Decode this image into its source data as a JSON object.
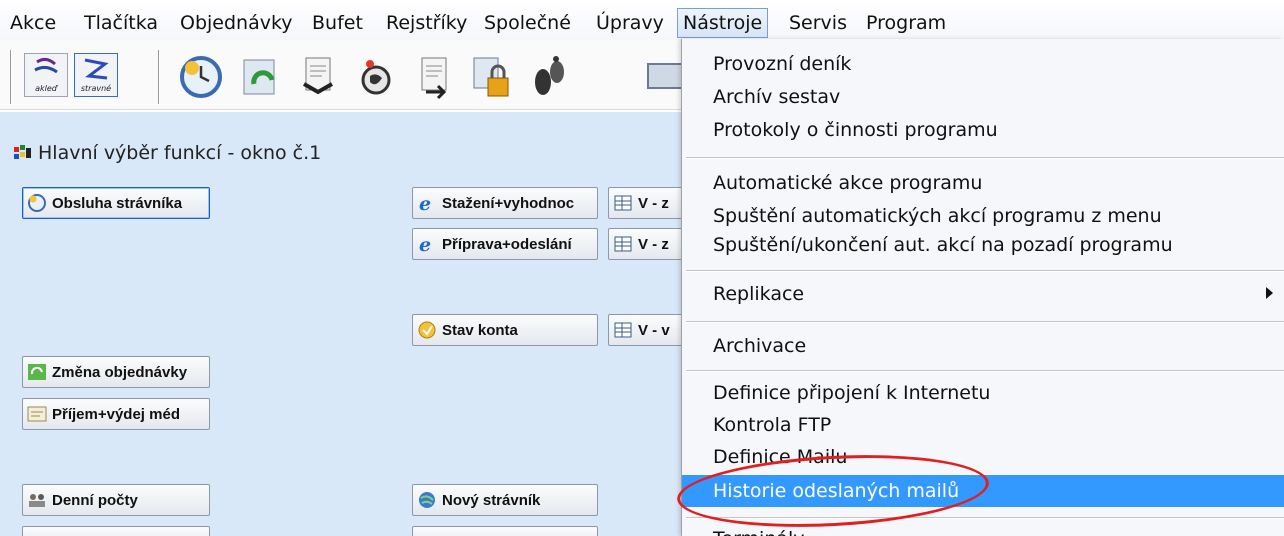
{
  "menubar": {
    "items": [
      "Akce",
      "Tlačítka",
      "Objednávky",
      "Bufet",
      "Rejstříky",
      "Společné",
      "Úpravy",
      "Nástroje",
      "Servis",
      "Program"
    ]
  },
  "toolbar": {
    "small_buttons": [
      "akleď",
      "stravné"
    ],
    "icons": [
      "clock-icon",
      "refresh-icon",
      "document-export-icon",
      "hand-pointer-icon",
      "document-import-icon",
      "lock-icon",
      "footprints-icon",
      "monitor-icon"
    ]
  },
  "main": {
    "title": "Hlavní výběr funkcí - okno č.1",
    "buttons": {
      "obsluha": "Obsluha strávníka",
      "stazeni": "Stažení+vyhodnoc",
      "v1": "V - z",
      "priprava": "Příprava+odeslání",
      "v2": "V - z",
      "stav": "Stav konta",
      "v3": "V - v",
      "zmena": "Změna objednávky",
      "prijem": "Příjem+výdej méd",
      "denni": "Denní počty",
      "novy": "Nový strávník"
    }
  },
  "dropdown": {
    "items": [
      "Provozní deník",
      "Archív sestav",
      "Protokoly o činnosti programu",
      "Automatické akce programu",
      "Spuštění automatických akcí programu z menu",
      "Spuštění/ukončení aut. akcí na pozadí programu",
      "Replikace",
      "Archivace",
      "Definice připojení k Internetu",
      "Kontrola FTP",
      "Definice Mailu",
      "Historie odeslaných mailů",
      "Terminály"
    ],
    "highlighted_item": "Historie odeslaných mailů"
  },
  "colors": {
    "menu_highlight": "#3399ff",
    "annotation_circle": "#e02020",
    "main_background": "#d8e8f8"
  }
}
